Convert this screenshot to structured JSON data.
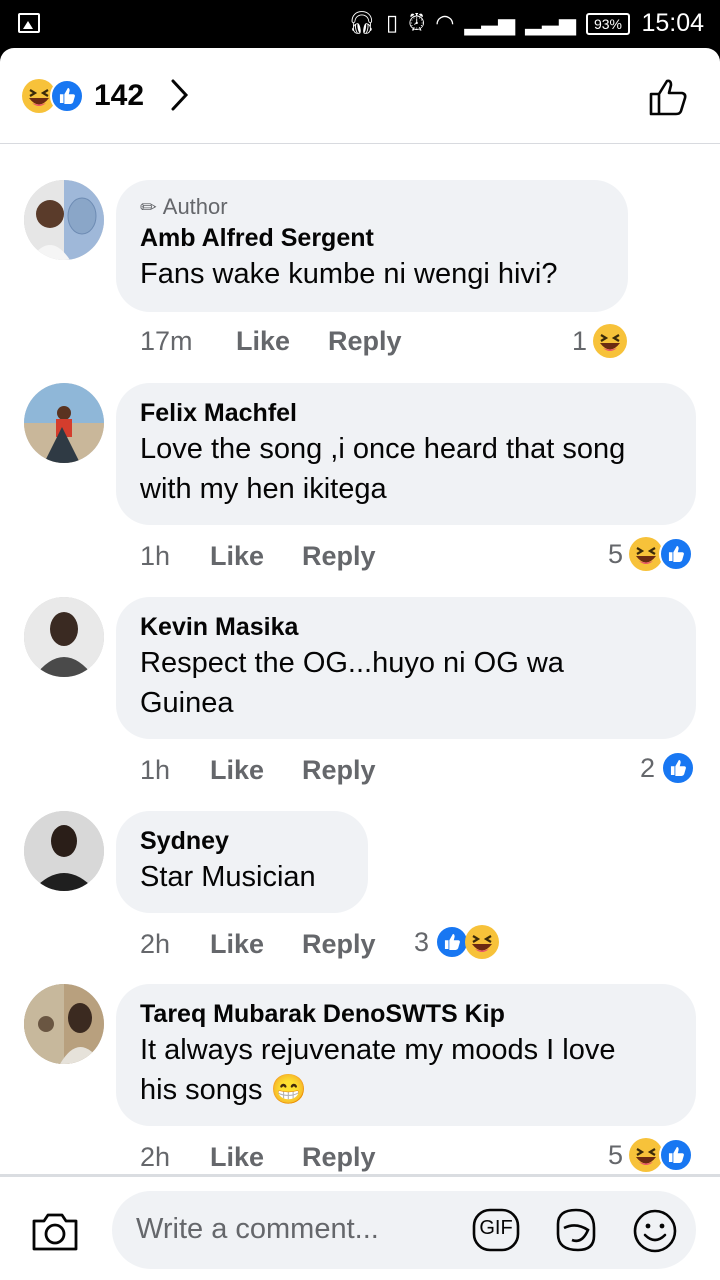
{
  "status_bar": {
    "battery": "93%",
    "time": "15:04",
    "icons": [
      "gallery-icon",
      "headphones-icon",
      "vibrate-icon",
      "alarm-icon",
      "wifi-icon",
      "signal-icon",
      "signal-icon"
    ]
  },
  "header": {
    "reaction_total": "142",
    "reaction_types": [
      "haha",
      "like"
    ]
  },
  "comments": [
    {
      "badge": "Author",
      "name": "Amb Alfred Sergent",
      "text_lines": [
        "Fans wake kumbe ni wengi hivi?"
      ],
      "time": "17m",
      "like_label": "Like",
      "reply_label": "Reply",
      "reaction_count": "1",
      "reactions": [
        "haha"
      ]
    },
    {
      "name": "Felix Machfel",
      "text_lines": [
        "Love the song ,i once heard that song",
        "with my hen ikitega"
      ],
      "time": "1h",
      "like_label": "Like",
      "reply_label": "Reply",
      "reaction_count": "5",
      "reactions": [
        "haha",
        "like"
      ]
    },
    {
      "name": "Kevin Masika",
      "text_lines": [
        "Respect the OG...huyo ni OG wa",
        "Guinea"
      ],
      "time": "1h",
      "like_label": "Like",
      "reply_label": "Reply",
      "reaction_count": "2",
      "reactions": [
        "like"
      ]
    },
    {
      "name": "Sydney",
      "text_lines": [
        "Star Musician"
      ],
      "time": "2h",
      "like_label": "Like",
      "reply_label": "Reply",
      "reaction_count": "3",
      "reactions": [
        "like",
        "haha"
      ]
    },
    {
      "name": "Tareq Mubarak DenoSWTS Kip",
      "text_lines": [
        "It always rejuvenate my moods I love",
        "his songs 😁"
      ],
      "time": "2h",
      "like_label": "Like",
      "reply_label": "Reply",
      "reaction_count": "5",
      "reactions": [
        "haha",
        "like"
      ]
    }
  ],
  "composer": {
    "placeholder": "Write a comment...",
    "gif_label": "GIF"
  },
  "colors": {
    "accent": "#1877f2",
    "haha": "#f7c23a",
    "bubble": "#f0f2f5",
    "secondary_text": "#65676b"
  }
}
